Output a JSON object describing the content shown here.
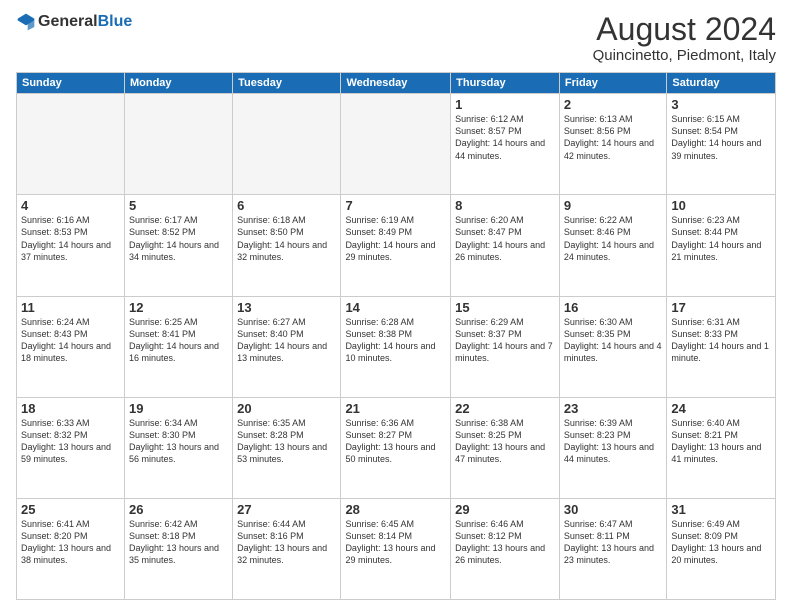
{
  "header": {
    "logo_general": "General",
    "logo_blue": "Blue",
    "month_year": "August 2024",
    "location": "Quincinetto, Piedmont, Italy"
  },
  "days_of_week": [
    "Sunday",
    "Monday",
    "Tuesday",
    "Wednesday",
    "Thursday",
    "Friday",
    "Saturday"
  ],
  "weeks": [
    [
      {
        "day": "",
        "info": ""
      },
      {
        "day": "",
        "info": ""
      },
      {
        "day": "",
        "info": ""
      },
      {
        "day": "",
        "info": ""
      },
      {
        "day": "1",
        "info": "Sunrise: 6:12 AM\nSunset: 8:57 PM\nDaylight: 14 hours and 44 minutes."
      },
      {
        "day": "2",
        "info": "Sunrise: 6:13 AM\nSunset: 8:56 PM\nDaylight: 14 hours and 42 minutes."
      },
      {
        "day": "3",
        "info": "Sunrise: 6:15 AM\nSunset: 8:54 PM\nDaylight: 14 hours and 39 minutes."
      }
    ],
    [
      {
        "day": "4",
        "info": "Sunrise: 6:16 AM\nSunset: 8:53 PM\nDaylight: 14 hours and 37 minutes."
      },
      {
        "day": "5",
        "info": "Sunrise: 6:17 AM\nSunset: 8:52 PM\nDaylight: 14 hours and 34 minutes."
      },
      {
        "day": "6",
        "info": "Sunrise: 6:18 AM\nSunset: 8:50 PM\nDaylight: 14 hours and 32 minutes."
      },
      {
        "day": "7",
        "info": "Sunrise: 6:19 AM\nSunset: 8:49 PM\nDaylight: 14 hours and 29 minutes."
      },
      {
        "day": "8",
        "info": "Sunrise: 6:20 AM\nSunset: 8:47 PM\nDaylight: 14 hours and 26 minutes."
      },
      {
        "day": "9",
        "info": "Sunrise: 6:22 AM\nSunset: 8:46 PM\nDaylight: 14 hours and 24 minutes."
      },
      {
        "day": "10",
        "info": "Sunrise: 6:23 AM\nSunset: 8:44 PM\nDaylight: 14 hours and 21 minutes."
      }
    ],
    [
      {
        "day": "11",
        "info": "Sunrise: 6:24 AM\nSunset: 8:43 PM\nDaylight: 14 hours and 18 minutes."
      },
      {
        "day": "12",
        "info": "Sunrise: 6:25 AM\nSunset: 8:41 PM\nDaylight: 14 hours and 16 minutes."
      },
      {
        "day": "13",
        "info": "Sunrise: 6:27 AM\nSunset: 8:40 PM\nDaylight: 14 hours and 13 minutes."
      },
      {
        "day": "14",
        "info": "Sunrise: 6:28 AM\nSunset: 8:38 PM\nDaylight: 14 hours and 10 minutes."
      },
      {
        "day": "15",
        "info": "Sunrise: 6:29 AM\nSunset: 8:37 PM\nDaylight: 14 hours and 7 minutes."
      },
      {
        "day": "16",
        "info": "Sunrise: 6:30 AM\nSunset: 8:35 PM\nDaylight: 14 hours and 4 minutes."
      },
      {
        "day": "17",
        "info": "Sunrise: 6:31 AM\nSunset: 8:33 PM\nDaylight: 14 hours and 1 minute."
      }
    ],
    [
      {
        "day": "18",
        "info": "Sunrise: 6:33 AM\nSunset: 8:32 PM\nDaylight: 13 hours and 59 minutes."
      },
      {
        "day": "19",
        "info": "Sunrise: 6:34 AM\nSunset: 8:30 PM\nDaylight: 13 hours and 56 minutes."
      },
      {
        "day": "20",
        "info": "Sunrise: 6:35 AM\nSunset: 8:28 PM\nDaylight: 13 hours and 53 minutes."
      },
      {
        "day": "21",
        "info": "Sunrise: 6:36 AM\nSunset: 8:27 PM\nDaylight: 13 hours and 50 minutes."
      },
      {
        "day": "22",
        "info": "Sunrise: 6:38 AM\nSunset: 8:25 PM\nDaylight: 13 hours and 47 minutes."
      },
      {
        "day": "23",
        "info": "Sunrise: 6:39 AM\nSunset: 8:23 PM\nDaylight: 13 hours and 44 minutes."
      },
      {
        "day": "24",
        "info": "Sunrise: 6:40 AM\nSunset: 8:21 PM\nDaylight: 13 hours and 41 minutes."
      }
    ],
    [
      {
        "day": "25",
        "info": "Sunrise: 6:41 AM\nSunset: 8:20 PM\nDaylight: 13 hours and 38 minutes."
      },
      {
        "day": "26",
        "info": "Sunrise: 6:42 AM\nSunset: 8:18 PM\nDaylight: 13 hours and 35 minutes."
      },
      {
        "day": "27",
        "info": "Sunrise: 6:44 AM\nSunset: 8:16 PM\nDaylight: 13 hours and 32 minutes."
      },
      {
        "day": "28",
        "info": "Sunrise: 6:45 AM\nSunset: 8:14 PM\nDaylight: 13 hours and 29 minutes."
      },
      {
        "day": "29",
        "info": "Sunrise: 6:46 AM\nSunset: 8:12 PM\nDaylight: 13 hours and 26 minutes."
      },
      {
        "day": "30",
        "info": "Sunrise: 6:47 AM\nSunset: 8:11 PM\nDaylight: 13 hours and 23 minutes."
      },
      {
        "day": "31",
        "info": "Sunrise: 6:49 AM\nSunset: 8:09 PM\nDaylight: 13 hours and 20 minutes."
      }
    ]
  ]
}
